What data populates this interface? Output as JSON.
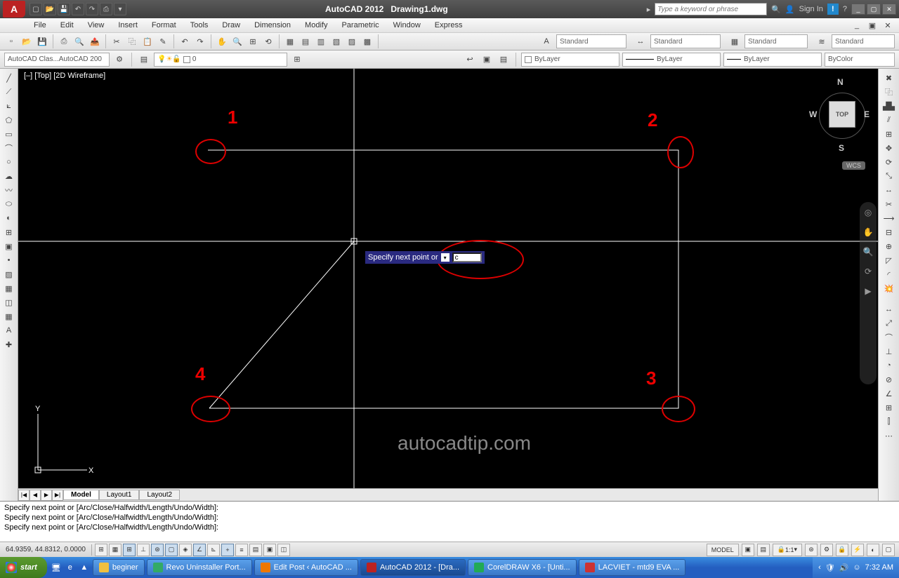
{
  "title": {
    "app": "AutoCAD 2012",
    "doc": "Drawing1.dwg"
  },
  "search_placeholder": "Type a keyword or phrase",
  "signin": "Sign In",
  "menus": [
    "File",
    "Edit",
    "View",
    "Insert",
    "Format",
    "Tools",
    "Draw",
    "Dimension",
    "Modify",
    "Parametric",
    "Window",
    "Express"
  ],
  "styles": {
    "text": "Standard",
    "dim": "Standard",
    "table": "Standard",
    "ml": "Standard"
  },
  "workspace": "AutoCAD Clas...AutoCAD 200",
  "layer": "0",
  "bylayer": {
    "color": "ByLayer",
    "line": "ByLayer",
    "lw": "ByLayer",
    "plot": "ByColor"
  },
  "view_label": "[–] [Top] [2D Wireframe]",
  "viewcube": {
    "top": "TOP",
    "n": "N",
    "s": "S",
    "e": "E",
    "w": "W",
    "wcs": "WCS"
  },
  "dyn_prompt": "Specify next point or",
  "dyn_value": "c",
  "annotations": {
    "1": "1",
    "2": "2",
    "3": "3",
    "4": "4"
  },
  "watermark": "autocadtip.com",
  "tabs": [
    "Model",
    "Layout1",
    "Layout2"
  ],
  "cmd_lines": [
    "Specify next point or [Arc/Close/Halfwidth/Length/Undo/Width]:",
    "Specify next point or [Arc/Close/Halfwidth/Length/Undo/Width]:",
    "",
    "Specify next point or [Arc/Close/Halfwidth/Length/Undo/Width]:"
  ],
  "status": {
    "coords": "64.9359, 44.8312, 0.0000",
    "model": "MODEL",
    "scale": "1:1"
  },
  "taskbar": {
    "start": "start",
    "items": [
      {
        "label": "beginer",
        "ico": "#f0c040"
      },
      {
        "label": "Revo Uninstaller Port...",
        "ico": "#3a6"
      },
      {
        "label": "Edit Post ‹ AutoCAD ...",
        "ico": "#e70"
      },
      {
        "label": "AutoCAD 2012 - [Dra...",
        "ico": "#b22",
        "active": true
      },
      {
        "label": "CorelDRAW X6 - [Unti...",
        "ico": "#2a5"
      },
      {
        "label": "LACVIET - mtd9 EVA ...",
        "ico": "#c33"
      }
    ],
    "clock": "7:32 AM"
  }
}
